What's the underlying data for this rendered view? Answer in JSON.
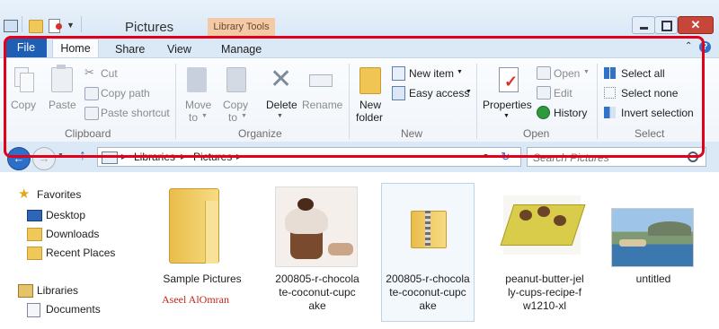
{
  "window": {
    "title": "Pictures",
    "context_tab": "Library Tools"
  },
  "ribbon_tabs": {
    "file": "File",
    "home": "Home",
    "share": "Share",
    "view": "View",
    "manage": "Manage"
  },
  "clipboard": {
    "copy": "Copy",
    "paste": "Paste",
    "cut": "Cut",
    "copy_path": "Copy path",
    "paste_shortcut": "Paste shortcut",
    "group": "Clipboard"
  },
  "organize": {
    "move_to_1": "Move",
    "move_to_2": "to",
    "copy_to_1": "Copy",
    "copy_to_2": "to",
    "delete": "Delete",
    "rename": "Rename",
    "group": "Organize"
  },
  "new": {
    "new_folder_1": "New",
    "new_folder_2": "folder",
    "new_item": "New item",
    "easy_access": "Easy access",
    "group": "New"
  },
  "open": {
    "properties": "Properties",
    "open": "Open",
    "edit": "Edit",
    "history": "History",
    "group": "Open"
  },
  "select": {
    "select_all": "Select all",
    "select_none": "Select none",
    "invert_selection": "Invert selection",
    "group": "Select"
  },
  "address": {
    "crumbs": [
      "Libraries",
      "Pictures"
    ],
    "search_placeholder": "Search Pictures"
  },
  "nav_pane": {
    "favorites": "Favorites",
    "desktop": "Desktop",
    "downloads": "Downloads",
    "recent_places": "Recent Places",
    "libraries": "Libraries",
    "documents": "Documents"
  },
  "files": [
    {
      "lines": [
        "Sample Pictures"
      ]
    },
    {
      "lines": [
        "200805-r-chocola",
        "te-coconut-cupc",
        "ake"
      ]
    },
    {
      "lines": [
        "200805-r-chocola",
        "te-coconut-cupc",
        "ake"
      ]
    },
    {
      "lines": [
        "peanut-butter-jel",
        "ly-cups-recipe-f",
        "w1210-xl"
      ]
    },
    {
      "lines": [
        "untitled"
      ]
    }
  ],
  "watermark": "Aseel AlOmran",
  "colors": {
    "highlight_box": "#e2001a",
    "file_tab": "#1f5fb3",
    "library_tools_tab": "#f3c9a6"
  }
}
